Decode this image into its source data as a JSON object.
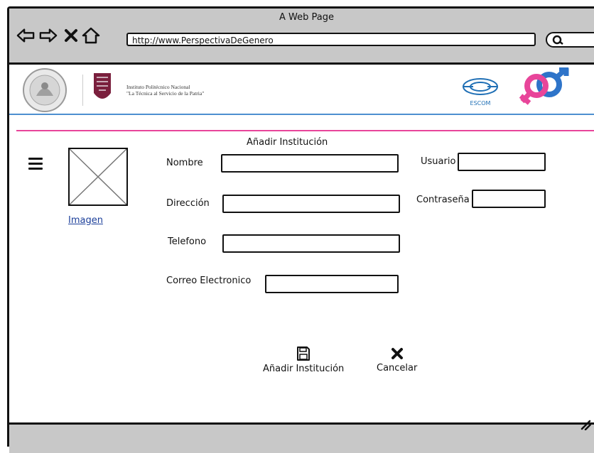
{
  "window": {
    "title": "A Web Page",
    "url": "http://www.PerspectivaDeGenero"
  },
  "header": {
    "institution_line1": "Instituto Politécnico Nacional",
    "institution_line2": "\"La Técnica al Servicio de la Patria\"",
    "escom_label": "ESCOM"
  },
  "form": {
    "title": "Añadir Institución",
    "image_link": "Imagen",
    "fields": {
      "nombre": {
        "label": "Nombre",
        "value": ""
      },
      "direccion": {
        "label": "Dirección",
        "value": ""
      },
      "telefono": {
        "label": "Telefono",
        "value": ""
      },
      "correo": {
        "label": "Correo Electronico",
        "value": ""
      },
      "usuario": {
        "label": "Usuario",
        "value": ""
      },
      "contrasena": {
        "label": "Contraseña",
        "value": ""
      }
    },
    "actions": {
      "add_label": "Añadir Institución",
      "cancel_label": "Cancelar"
    }
  },
  "colors": {
    "chrome": "#c8c8c8",
    "accent_blue": "#4d8fd0",
    "accent_pink": "#e8459a",
    "link": "#1c3f9a"
  },
  "icons": [
    "back-arrow-icon",
    "forward-arrow-icon",
    "close-icon",
    "home-icon",
    "search-icon",
    "menu-icon",
    "image-placeholder-icon",
    "save-icon",
    "cancel-x-icon",
    "resize-icon"
  ]
}
